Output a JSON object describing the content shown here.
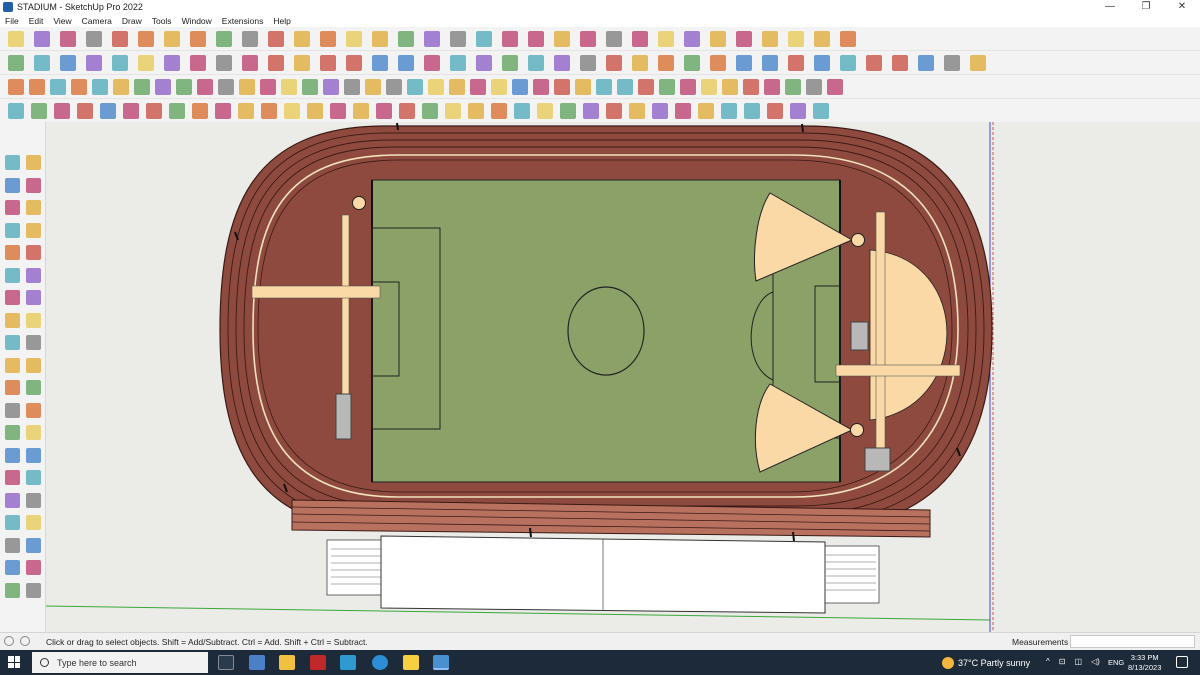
{
  "window": {
    "title": "STADIUM - SketchUp Pro 2022",
    "controls": [
      "—",
      "❐",
      "✕"
    ]
  },
  "menu": [
    "File",
    "Edit",
    "View",
    "Camera",
    "Draw",
    "Tools",
    "Window",
    "Extensions",
    "Help"
  ],
  "status": {
    "hint": "Click or drag to select objects. Shift = Add/Subtract. Ctrl = Add. Shift + Ctrl = Subtract.",
    "measurements_label": "Measurements",
    "measurements_value": ""
  },
  "taskbar": {
    "search_placeholder": "Type here to search",
    "weather": "37°C  Partly sunny",
    "lang": "ENG",
    "time": "3:33 PM",
    "date": "8/13/2023",
    "tray": [
      "^",
      "⊡",
      "◫",
      "◁)"
    ]
  },
  "colors": {
    "track": "#8e4a3e",
    "track_line": "#3a1a14",
    "field": "#8ba167",
    "facility": "#fbd9a6",
    "stand_front": "#b8705f",
    "bleacher": "#ffffff",
    "axis_red": "#c73030",
    "axis_green": "#3aa83a",
    "axis_blue": "#4848d8"
  },
  "toolbar_icons": {
    "row1": [
      "zoom-icon",
      "select-icon",
      "eraser-icon",
      "line-icon",
      "arc-icon",
      "shape-icon",
      "push-pull-icon",
      "follow-me-icon",
      "move-icon",
      "rotate-icon",
      "scale-icon",
      "tape-icon",
      "text-icon",
      "paint-icon",
      "orbit-icon",
      "pan-icon",
      "zoom-window-icon",
      "zoom-extents-icon",
      "section-icon",
      "display-section-icon",
      "section-fill-icon",
      "user-icon",
      "styles-icon",
      "xray-icon",
      "back-edges-icon",
      "wireframe-icon",
      "hidden-line-icon",
      "shaded-icon",
      "textures-icon",
      "monochrome-icon",
      "undo-icon",
      "redo-icon",
      "flip-icon"
    ],
    "row2": [
      "iso-view-icon",
      "top-view-icon",
      "front-view-icon",
      "right-view-icon",
      "back-view-icon",
      "left-view-icon",
      "bottom-view-icon",
      "perspective-icon",
      "component-icon",
      "group-icon",
      "house-icon",
      "home-icon",
      "warehouse-icon",
      "window-icon",
      "door-icon",
      "solid-union-icon",
      "solid-subtract-icon",
      "solid-trim-icon",
      "solid-intersect-icon",
      "solid-split-icon",
      "outer-shell-icon",
      "pencil-icon",
      "sandbox-icon",
      "smoove-icon",
      "stamp-icon",
      "drape-icon",
      "add-detail-icon",
      "flip-edge-icon",
      "warehouse-3d-icon",
      "extension-icon",
      "layer-icon",
      "tag-icon",
      "scene-icon",
      "shadow-icon",
      "fog-icon",
      "match-photo-icon",
      "photo-icon",
      "soften-icon"
    ],
    "row3": [
      "shape-blue-icon",
      "diamond-icon",
      "prism-icon",
      "prism-green-icon",
      "prism-red-icon",
      "cube-outline-icon",
      "arc-orange-icon",
      "rect-red-icon",
      "list-icon",
      "frame-icon",
      "doc-icon",
      "grid-icon",
      "stairs-icon",
      "floor-icon",
      "column-icon",
      "rail-icon",
      "arrow-icon",
      "cursor-icon",
      "group-red-icon",
      "beam-icon",
      "pipe-icon",
      "tube-icon",
      "offset-icon",
      "sweep-icon",
      "loft-icon",
      "extrude-icon",
      "revolve-icon",
      "fillet-icon",
      "chamfer-icon",
      "bend-icon",
      "twist-icon",
      "shell-icon",
      "mirror-icon",
      "array-icon",
      "align-icon",
      "distribute-icon",
      "snap-icon",
      "measure-icon",
      "dimension-icon",
      "label-icon"
    ],
    "row4": [
      "select-row4-icon",
      "curve-icon",
      "bezier-icon",
      "spline-icon",
      "arc3-icon",
      "circle3-icon",
      "polygon-icon",
      "ellipse-icon",
      "spiral-icon",
      "helix-icon",
      "offset2-icon",
      "fillet2-icon",
      "chamfer2-icon",
      "extrude2-icon",
      "joint-push-icon",
      "round-corner-icon",
      "roof-icon",
      "wall-icon",
      "slab-icon",
      "opening-icon",
      "railing-icon",
      "column2-icon",
      "beam2-icon",
      "truss-icon",
      "stair2-icon",
      "ramp-icon",
      "ceiling-icon",
      "floor2-icon",
      "grid2-icon",
      "hatch-icon",
      "pattern-icon",
      "texture2-icon",
      "light-icon",
      "render-icon",
      "camera2-icon",
      "export-icon"
    ]
  },
  "left_icons": [
    "select-tool-icon",
    "orbit-tool-icon",
    "paint-bucket-icon",
    "eraser-tool-icon",
    "component-tool-icon",
    "tape-measure-icon",
    "line-tool-icon",
    "freehand-icon",
    "rectangle-tool-icon",
    "rotated-rect-icon",
    "circle-tool-icon",
    "polygon-tool-icon",
    "arc-tool-icon",
    "pie-tool-icon",
    "arc2-tool-icon",
    "arc3-tool-icon",
    "move-tool-icon",
    "push-pull-tool-icon",
    "rotate-tool-icon",
    "follow-me-tool-icon",
    "scale-tool-icon",
    "offset-tool-icon",
    "tape-tool-icon",
    "text-tool-icon",
    "protractor-icon",
    "axes-tool-icon",
    "dimension-tool-icon",
    "3d-text-icon",
    "orbit2-icon",
    "pan-tool-icon",
    "zoom-tool-icon",
    "zoom-window-tool-icon",
    "zoom-extents-tool-icon",
    "previous-view-icon",
    "position-camera-icon",
    "look-around-icon",
    "walk-icon",
    "section-plane-icon",
    "sandbox-tool-icon",
    "drape-tool-icon"
  ]
}
